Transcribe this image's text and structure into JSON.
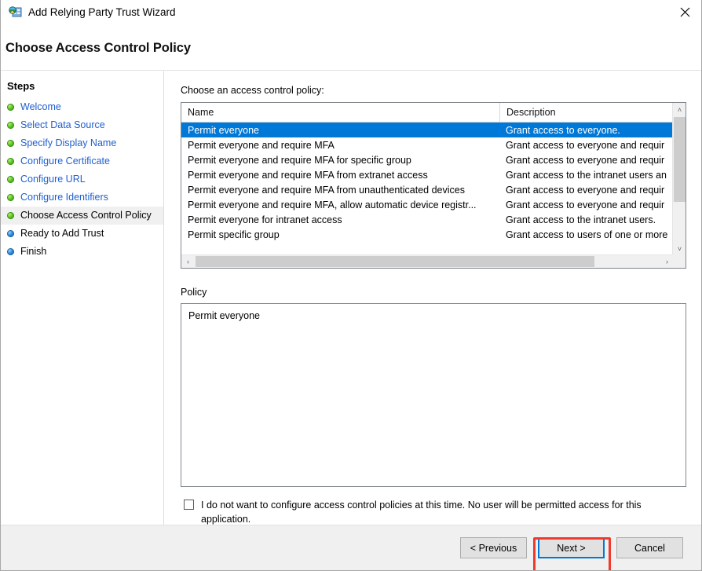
{
  "window": {
    "title": "Add Relying Party Trust Wizard",
    "icon": "adfs-relying-party-icon",
    "close_label": "✕"
  },
  "header": {
    "page_title": "Choose Access Control Policy"
  },
  "sidebar": {
    "title": "Steps",
    "items": [
      {
        "label": "Welcome",
        "state": "done"
      },
      {
        "label": "Select Data Source",
        "state": "done"
      },
      {
        "label": "Specify Display Name",
        "state": "done"
      },
      {
        "label": "Configure Certificate",
        "state": "done"
      },
      {
        "label": "Configure URL",
        "state": "done"
      },
      {
        "label": "Configure Identifiers",
        "state": "done"
      },
      {
        "label": "Choose Access Control Policy",
        "state": "current"
      },
      {
        "label": "Ready to Add Trust",
        "state": "todo"
      },
      {
        "label": "Finish",
        "state": "todo"
      }
    ]
  },
  "main": {
    "choose_label": "Choose an access control policy:",
    "policy_label": "Policy",
    "policy_value": "Permit everyone",
    "columns": {
      "name": "Name",
      "description": "Description"
    },
    "rows": [
      {
        "name": "Permit everyone",
        "description": "Grant access to everyone.",
        "selected": true
      },
      {
        "name": "Permit everyone and require MFA",
        "description": "Grant access to everyone and requir",
        "selected": false
      },
      {
        "name": "Permit everyone and require MFA for specific group",
        "description": "Grant access to everyone and requir",
        "selected": false
      },
      {
        "name": "Permit everyone and require MFA from extranet access",
        "description": "Grant access to the intranet users an",
        "selected": false
      },
      {
        "name": "Permit everyone and require MFA from unauthenticated devices",
        "description": "Grant access to everyone and requir",
        "selected": false
      },
      {
        "name": "Permit everyone and require MFA, allow automatic device registr...",
        "description": "Grant access to everyone and requir",
        "selected": false
      },
      {
        "name": "Permit everyone for intranet access",
        "description": "Grant access to the intranet users.",
        "selected": false
      },
      {
        "name": "Permit specific group",
        "description": "Grant access to users of one or more",
        "selected": false
      }
    ],
    "checkbox": {
      "checked": false,
      "label": "I do not want to configure access control policies at this time. No user will be permitted access for this application."
    },
    "scrollbar": {
      "up_arrow": "˄",
      "down_arrow": "˅",
      "left_arrow": "‹",
      "right_arrow": "›"
    }
  },
  "footer": {
    "previous": "< Previous",
    "next": "Next >",
    "cancel": "Cancel"
  },
  "annotation": {
    "highlight_color": "#f03a2e",
    "focus_color": "#0078d7"
  }
}
